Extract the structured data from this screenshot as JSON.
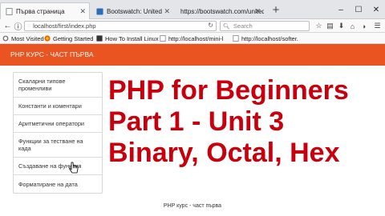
{
  "browser": {
    "tabs": [
      {
        "title": "Първа страница",
        "active": true
      },
      {
        "title": "Bootswatch: United",
        "active": false
      },
      {
        "title": "https://bootswatch.com/united/",
        "active": false
      }
    ],
    "url": "localhost/first/index.php",
    "search_placeholder": "Search",
    "bookmarks": [
      "Most Visited",
      "Getting Started",
      "How To Install Linux, ...",
      "http://localhost/mini-l...",
      "http://localhost/softer..."
    ]
  },
  "site": {
    "brand": "PHP КУРС - ЧАСТ ПЪРВА",
    "menu": [
      [
        "Скаларни типове",
        "променливи"
      ],
      [
        "Константи и коментари"
      ],
      [
        "Аритметични оператори"
      ],
      [
        "Функции за тестване на",
        "када"
      ],
      [
        "Създаване на функция"
      ],
      [
        "Форматиране на дата"
      ]
    ],
    "footer": "PHP курс - част първа"
  },
  "overlay": {
    "line1": "PHP for Beginners",
    "line2": "Part 1 - Unit 3",
    "line3": "Binary, Octal, Hex"
  },
  "colors": {
    "header": "#e95420",
    "overlay_text": "#c8000e"
  }
}
